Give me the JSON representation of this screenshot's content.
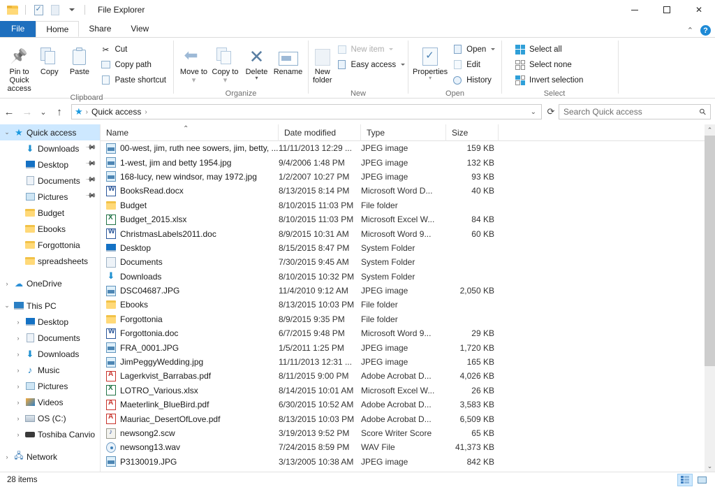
{
  "window": {
    "title": "File Explorer",
    "minimize_label": "Minimize",
    "maximize_label": "Maximize",
    "close_label": "Close",
    "help_label": "?"
  },
  "quick_access_toolbar": {
    "items": [
      {
        "name": "folder-icon",
        "label": ""
      },
      {
        "name": "properties-icon",
        "label": ""
      },
      {
        "name": "new-folder-icon",
        "label": ""
      },
      {
        "name": "customize-caret",
        "label": ""
      }
    ]
  },
  "ribbon": {
    "tabs": [
      {
        "label": "File",
        "active": false,
        "file": true
      },
      {
        "label": "Home",
        "active": true,
        "file": false
      },
      {
        "label": "Share",
        "active": false,
        "file": false
      },
      {
        "label": "View",
        "active": false,
        "file": false
      }
    ],
    "groups": {
      "clipboard": {
        "label": "Clipboard",
        "pin_label": "Pin to Quick access",
        "copy_label": "Copy",
        "paste_label": "Paste",
        "cut_label": "Cut",
        "copy_path_label": "Copy path",
        "paste_shortcut_label": "Paste shortcut"
      },
      "organize": {
        "label": "Organize",
        "move_to_label": "Move to",
        "copy_to_label": "Copy to",
        "delete_label": "Delete",
        "rename_label": "Rename"
      },
      "new": {
        "label": "New",
        "new_folder_label": "New folder",
        "new_item_label": "New item",
        "easy_access_label": "Easy access"
      },
      "open": {
        "label": "Open",
        "properties_label": "Properties",
        "open_label": "Open",
        "edit_label": "Edit",
        "history_label": "History"
      },
      "select": {
        "label": "Select",
        "select_all_label": "Select all",
        "select_none_label": "Select none",
        "invert_selection_label": "Invert selection"
      }
    }
  },
  "addressbar": {
    "back_label": "Back",
    "forward_label": "Forward",
    "recent_label": "Recent locations",
    "up_label": "Up",
    "breadcrumb": [
      "Quick access"
    ],
    "refresh_label": "Refresh"
  },
  "search": {
    "placeholder": "Search Quick access"
  },
  "navpane": {
    "items": [
      {
        "label": "Quick access",
        "icon": "star-icon",
        "indent": 0,
        "twisty": "expanded",
        "selected": true,
        "pinned": false
      },
      {
        "label": "Downloads",
        "icon": "download-icon",
        "indent": 1,
        "twisty": "none",
        "selected": false,
        "pinned": true
      },
      {
        "label": "Desktop",
        "icon": "desktop-icon",
        "indent": 1,
        "twisty": "none",
        "selected": false,
        "pinned": true
      },
      {
        "label": "Documents",
        "icon": "documents-icon",
        "indent": 1,
        "twisty": "none",
        "selected": false,
        "pinned": true
      },
      {
        "label": "Pictures",
        "icon": "pictures-icon",
        "indent": 1,
        "twisty": "none",
        "selected": false,
        "pinned": true
      },
      {
        "label": "Budget",
        "icon": "folder-icon",
        "indent": 1,
        "twisty": "none",
        "selected": false,
        "pinned": false
      },
      {
        "label": "Ebooks",
        "icon": "folder-icon",
        "indent": 1,
        "twisty": "none",
        "selected": false,
        "pinned": false
      },
      {
        "label": "Forgottonia",
        "icon": "folder-icon",
        "indent": 1,
        "twisty": "none",
        "selected": false,
        "pinned": false
      },
      {
        "label": "spreadsheets",
        "icon": "folder-icon",
        "indent": 1,
        "twisty": "none",
        "selected": false,
        "pinned": false
      },
      {
        "label": "",
        "icon": "spacer",
        "indent": 0,
        "twisty": "none",
        "selected": false,
        "pinned": false
      },
      {
        "label": "OneDrive",
        "icon": "cloud-icon",
        "indent": 0,
        "twisty": "collapsed",
        "selected": false,
        "pinned": false
      },
      {
        "label": "",
        "icon": "spacer",
        "indent": 0,
        "twisty": "none",
        "selected": false,
        "pinned": false
      },
      {
        "label": "This PC",
        "icon": "pc-icon",
        "indent": 0,
        "twisty": "expanded",
        "selected": false,
        "pinned": false
      },
      {
        "label": "Desktop",
        "icon": "desktop-icon",
        "indent": 1,
        "twisty": "collapsed",
        "selected": false,
        "pinned": false
      },
      {
        "label": "Documents",
        "icon": "documents-icon",
        "indent": 1,
        "twisty": "collapsed",
        "selected": false,
        "pinned": false
      },
      {
        "label": "Downloads",
        "icon": "download-icon",
        "indent": 1,
        "twisty": "collapsed",
        "selected": false,
        "pinned": false
      },
      {
        "label": "Music",
        "icon": "music-icon",
        "indent": 1,
        "twisty": "collapsed",
        "selected": false,
        "pinned": false
      },
      {
        "label": "Pictures",
        "icon": "pictures-icon",
        "indent": 1,
        "twisty": "collapsed",
        "selected": false,
        "pinned": false
      },
      {
        "label": "Videos",
        "icon": "videos-icon",
        "indent": 1,
        "twisty": "collapsed",
        "selected": false,
        "pinned": false
      },
      {
        "label": "OS (C:)",
        "icon": "drive-icon",
        "indent": 1,
        "twisty": "collapsed",
        "selected": false,
        "pinned": false
      },
      {
        "label": "Toshiba Canvio I",
        "icon": "external-drive-icon",
        "indent": 1,
        "twisty": "collapsed",
        "selected": false,
        "pinned": false
      },
      {
        "label": "",
        "icon": "spacer",
        "indent": 0,
        "twisty": "none",
        "selected": false,
        "pinned": false
      },
      {
        "label": "Network",
        "icon": "network-icon",
        "indent": 0,
        "twisty": "collapsed",
        "selected": false,
        "pinned": false
      }
    ]
  },
  "filelist": {
    "columns": [
      {
        "label": "Name",
        "sorted": "asc"
      },
      {
        "label": "Date modified",
        "sorted": ""
      },
      {
        "label": "Type",
        "sorted": ""
      },
      {
        "label": "Size",
        "sorted": ""
      }
    ],
    "rows": [
      {
        "name": "00-west, jim, ruth nee sowers, jim, betty, ...",
        "date": "11/11/2013 12:29 ...",
        "type": "JPEG image",
        "size": "159 KB",
        "icon": "jpeg-file-icon"
      },
      {
        "name": "1-west,  jim and betty 1954.jpg",
        "date": "9/4/2006 1:48 PM",
        "type": "JPEG image",
        "size": "132 KB",
        "icon": "jpeg-file-icon"
      },
      {
        "name": "168-lucy, new windsor, may 1972.jpg",
        "date": "1/2/2007 10:27 PM",
        "type": "JPEG image",
        "size": "93 KB",
        "icon": "jpeg-file-icon"
      },
      {
        "name": "BooksRead.docx",
        "date": "8/13/2015 8:14 PM",
        "type": "Microsoft Word D...",
        "size": "40 KB",
        "icon": "word-file-icon"
      },
      {
        "name": "Budget",
        "date": "8/10/2015 11:03 PM",
        "type": "File folder",
        "size": "",
        "icon": "folder-icon"
      },
      {
        "name": "Budget_2015.xlsx",
        "date": "8/10/2015 11:03 PM",
        "type": "Microsoft Excel W...",
        "size": "84 KB",
        "icon": "excel-file-icon"
      },
      {
        "name": "ChristmasLabels2011.doc",
        "date": "8/9/2015 10:31 AM",
        "type": "Microsoft Word 9...",
        "size": "60 KB",
        "icon": "word-file-icon"
      },
      {
        "name": "Desktop",
        "date": "8/15/2015 8:47 PM",
        "type": "System Folder",
        "size": "",
        "icon": "desktop-icon"
      },
      {
        "name": "Documents",
        "date": "7/30/2015 9:45 AM",
        "type": "System Folder",
        "size": "",
        "icon": "documents-icon"
      },
      {
        "name": "Downloads",
        "date": "8/10/2015 10:32 PM",
        "type": "System Folder",
        "size": "",
        "icon": "download-icon"
      },
      {
        "name": "DSC04687.JPG",
        "date": "11/4/2010 9:12 AM",
        "type": "JPEG image",
        "size": "2,050 KB",
        "icon": "jpeg-file-icon"
      },
      {
        "name": "Ebooks",
        "date": "8/13/2015 10:03 PM",
        "type": "File folder",
        "size": "",
        "icon": "folder-icon"
      },
      {
        "name": "Forgottonia",
        "date": "8/9/2015 9:35 PM",
        "type": "File folder",
        "size": "",
        "icon": "folder-icon"
      },
      {
        "name": "Forgottonia.doc",
        "date": "6/7/2015 9:48 PM",
        "type": "Microsoft Word 9...",
        "size": "29 KB",
        "icon": "word-file-icon"
      },
      {
        "name": "FRA_0001.JPG",
        "date": "1/5/2011 1:25 PM",
        "type": "JPEG image",
        "size": "1,720 KB",
        "icon": "jpeg-file-icon"
      },
      {
        "name": "JimPeggyWedding.jpg",
        "date": "11/11/2013 12:31 ...",
        "type": "JPEG image",
        "size": "165 KB",
        "icon": "jpeg-file-icon"
      },
      {
        "name": "Lagerkvist_Barrabas.pdf",
        "date": "8/11/2015 9:00 PM",
        "type": "Adobe Acrobat D...",
        "size": "4,026 KB",
        "icon": "pdf-file-icon"
      },
      {
        "name": "LOTRO_Various.xlsx",
        "date": "8/14/2015 10:01 AM",
        "type": "Microsoft Excel W...",
        "size": "26 KB",
        "icon": "excel-file-icon"
      },
      {
        "name": "Maeterlink_BlueBird.pdf",
        "date": "6/30/2015 10:52 AM",
        "type": "Adobe Acrobat D...",
        "size": "3,583 KB",
        "icon": "pdf-file-icon"
      },
      {
        "name": "Mauriac_DesertOfLove.pdf",
        "date": "8/13/2015 10:03 PM",
        "type": "Adobe Acrobat D...",
        "size": "6,509 KB",
        "icon": "pdf-file-icon"
      },
      {
        "name": "newsong2.scw",
        "date": "3/19/2013 9:52 PM",
        "type": "Score Writer Score",
        "size": "65 KB",
        "icon": "score-file-icon"
      },
      {
        "name": "newsong13.wav",
        "date": "7/24/2015 8:59 PM",
        "type": "WAV File",
        "size": "41,373 KB",
        "icon": "wav-file-icon"
      },
      {
        "name": "P3130019.JPG",
        "date": "3/13/2005 10:38 AM",
        "type": "JPEG image",
        "size": "842 KB",
        "icon": "jpeg-file-icon"
      }
    ]
  },
  "statusbar": {
    "item_count": "28 items",
    "details_view_label": "Details view",
    "thumbnail_view_label": "Large icons view"
  },
  "colors": {
    "accent": "#1e6fbe",
    "selection": "#cde8ff",
    "folder": "#ffd978",
    "close_hover": "#e81123"
  }
}
